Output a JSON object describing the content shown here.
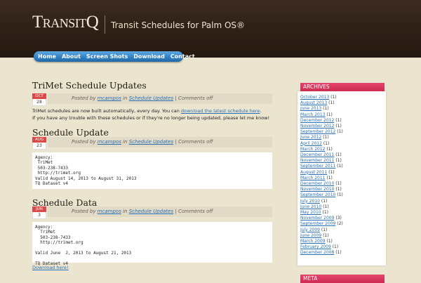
{
  "header": {
    "logo": "TransitQ",
    "tagline": "Transit Schedules for Palm OS®"
  },
  "nav": {
    "items": [
      "Home",
      "About",
      "Screen Shots",
      "Download",
      "Contact"
    ]
  },
  "posts": [
    {
      "title": "TriMet Schedule Updates",
      "month": "OCT",
      "day": "28",
      "posted_by_label": "Posted by",
      "author": "mcampos",
      "in_label": "in",
      "category": "Schedule Updates",
      "comments": "Comments off",
      "body_line1_pre": "TriMet schedules are now built automatically, every day. You can",
      "body_line1_link": "download the latest schedule here",
      "body_line1_post": ".",
      "body_line2": "If you have any trouble with these schedules or if they're no longer being updated, please let me know!"
    },
    {
      "title": "Schedule Update",
      "month": "AUG",
      "day": "23",
      "posted_by_label": "Posted by",
      "author": "mcampos",
      "in_label": "in",
      "category": "Schedule Updates",
      "comments": "Comments off",
      "code": "Agency:\n TriMet\n 503-238-7433\n http://trimet.org\nValid August 14, 2013 to August 31, 2013\nTQ Dataset v4"
    },
    {
      "title": "Schedule Data",
      "month": "JUN",
      "day": "3",
      "posted_by_label": "Posted by",
      "author": "mcampos",
      "in_label": "in",
      "category": "Schedule Updates",
      "comments": "Comments off",
      "code": "Agency:\n  TriMet\n  503-238-7433\n  http://trimet.org\n\nValid June  2, 2013 to August 21, 2013\n\nTQ Dataset v4",
      "download": "Download here!"
    }
  ],
  "sidebar": {
    "archives_title": "ARCHIVES",
    "archives": [
      {
        "month": "October 2013",
        "count": "(1)"
      },
      {
        "month": "August 2013",
        "count": "(1)"
      },
      {
        "month": "June 2013",
        "count": "(1)"
      },
      {
        "month": "March 2013",
        "count": "(1)"
      },
      {
        "month": "December 2012",
        "count": "(1)"
      },
      {
        "month": "November 2012",
        "count": "(1)"
      },
      {
        "month": "September 2012",
        "count": "(1)"
      },
      {
        "month": "June 2012",
        "count": "(1)"
      },
      {
        "month": "April 2012",
        "count": "(1)"
      },
      {
        "month": "March 2012",
        "count": "(1)"
      },
      {
        "month": "December 2011",
        "count": "(1)"
      },
      {
        "month": "November 2011",
        "count": "(1)"
      },
      {
        "month": "September 2011",
        "count": "(1)"
      },
      {
        "month": "August 2011",
        "count": "(1)"
      },
      {
        "month": "March 2011",
        "count": "(1)"
      },
      {
        "month": "December 2010",
        "count": "(1)"
      },
      {
        "month": "November 2010",
        "count": "(1)"
      },
      {
        "month": "September 2010",
        "count": "(1)"
      },
      {
        "month": "July 2010",
        "count": "(1)"
      },
      {
        "month": "June 2010",
        "count": "(1)"
      },
      {
        "month": "May 2010",
        "count": "(1)"
      },
      {
        "month": "November 2009",
        "count": "(3)"
      },
      {
        "month": "September 2009",
        "count": "(2)"
      },
      {
        "month": "July 2009",
        "count": "(1)"
      },
      {
        "month": "June 2009",
        "count": "(1)"
      },
      {
        "month": "March 2009",
        "count": "(1)"
      },
      {
        "month": "February 2009",
        "count": "(1)"
      },
      {
        "month": "December 2008",
        "count": "(1)"
      }
    ],
    "meta_title": "META"
  }
}
